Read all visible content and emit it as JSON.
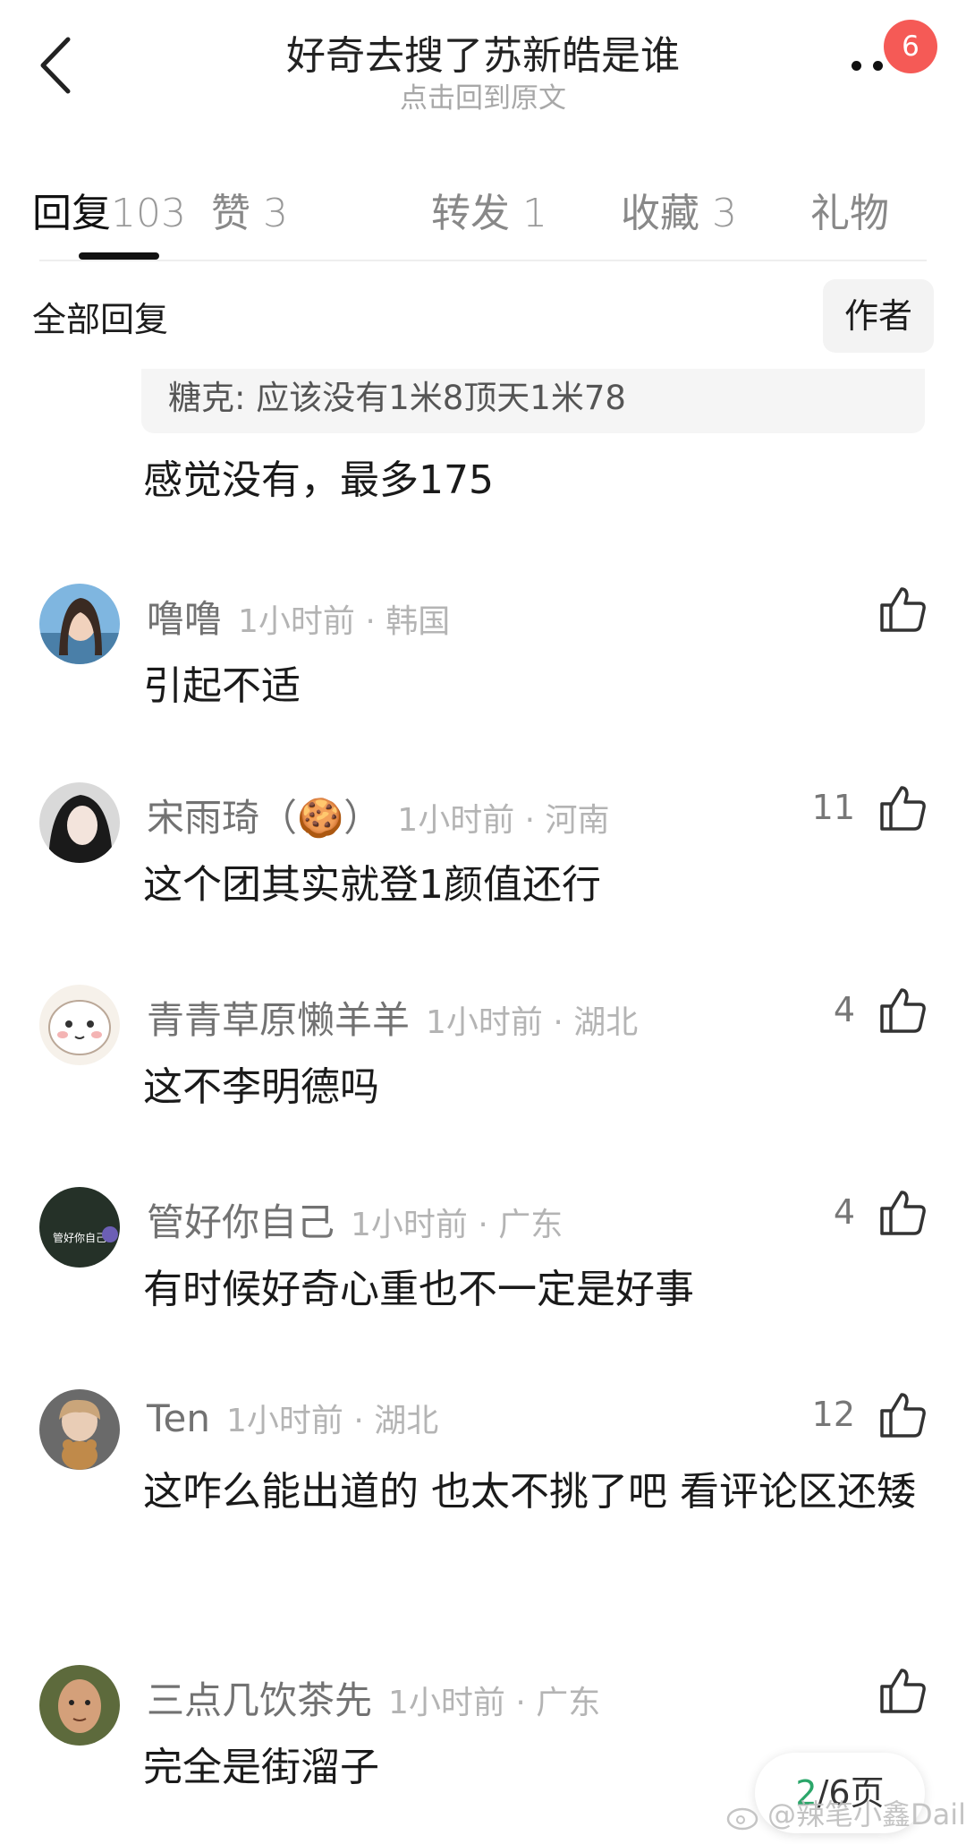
{
  "header": {
    "title": "好奇去搜了苏新皓是谁",
    "subtitle": "点击回到原文",
    "notification_count": "6"
  },
  "tabs": [
    {
      "label": "回复",
      "count": "103"
    },
    {
      "label": "赞",
      "count": "3"
    },
    {
      "label": "转发",
      "count": "1"
    },
    {
      "label": "收藏",
      "count": "3"
    },
    {
      "label": "礼物",
      "count": ""
    }
  ],
  "filter": {
    "label": "全部回复",
    "author_button": "作者"
  },
  "quoted_reply": {
    "text": "糖克: 应该没有1米8顶天1米78",
    "reply": "感觉没有，最多175"
  },
  "comments": [
    {
      "name": "噜噜",
      "time": "1小时前 · 韩国",
      "text": "引起不适",
      "likes": ""
    },
    {
      "name": "宋雨琦（🍪）",
      "time": "1小时前 · 河南",
      "text": "这个团其实就登1颜值还行",
      "likes": "11"
    },
    {
      "name": "青青草原懒羊羊",
      "time": "1小时前 · 湖北",
      "text": "这不李明德吗",
      "likes": "4"
    },
    {
      "name": "管好你自己",
      "time": "1小时前 · 广东",
      "text": "有时候好奇心重也不一定是好事",
      "likes": "4",
      "avatar_text": "管好你自己"
    },
    {
      "name": "Ten",
      "time": "1小时前 · 湖北",
      "text": "这咋么能出道的 也太不挑了吧 看评论区还矮",
      "likes": "12"
    },
    {
      "name": "三点几饮茶先",
      "time": "1小时前 · 广东",
      "text": "完全是街溜子",
      "likes": ""
    }
  ],
  "pager": {
    "current": "2",
    "rest": "/6页"
  },
  "watermark": "@辣笔小鑫Daily",
  "colors": {
    "badge": "#f55a56",
    "page_current": "#2ba66a"
  }
}
